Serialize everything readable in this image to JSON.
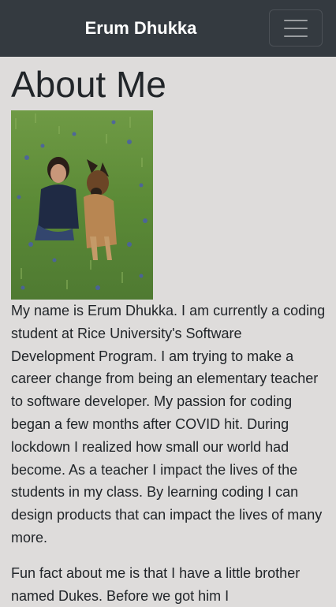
{
  "navbar": {
    "brand": "Erum Dhukka",
    "toggler_icon": "hamburger-menu-icon"
  },
  "main": {
    "title": "About Me",
    "photo_alt": "Erum with her dog in a field of bluebonnets",
    "paragraphs": [
      "My name is Erum Dhukka. I am currently a coding student at Rice University's Software Development Program. I am trying to make a career change from being an elementary teacher to software developer. My passion for coding began a few months after COVID hit. During lockdown I realized how small our world had become. As a teacher I impact the lives of the students in my class. By learning coding I can design products that can impact the lives of many more.",
      "Fun fact about me is that I have a little brother named Dukes. Before we got him I"
    ]
  },
  "colors": {
    "navbar_bg": "#343a40",
    "page_bg": "#dedcdb",
    "text": "#212529"
  }
}
